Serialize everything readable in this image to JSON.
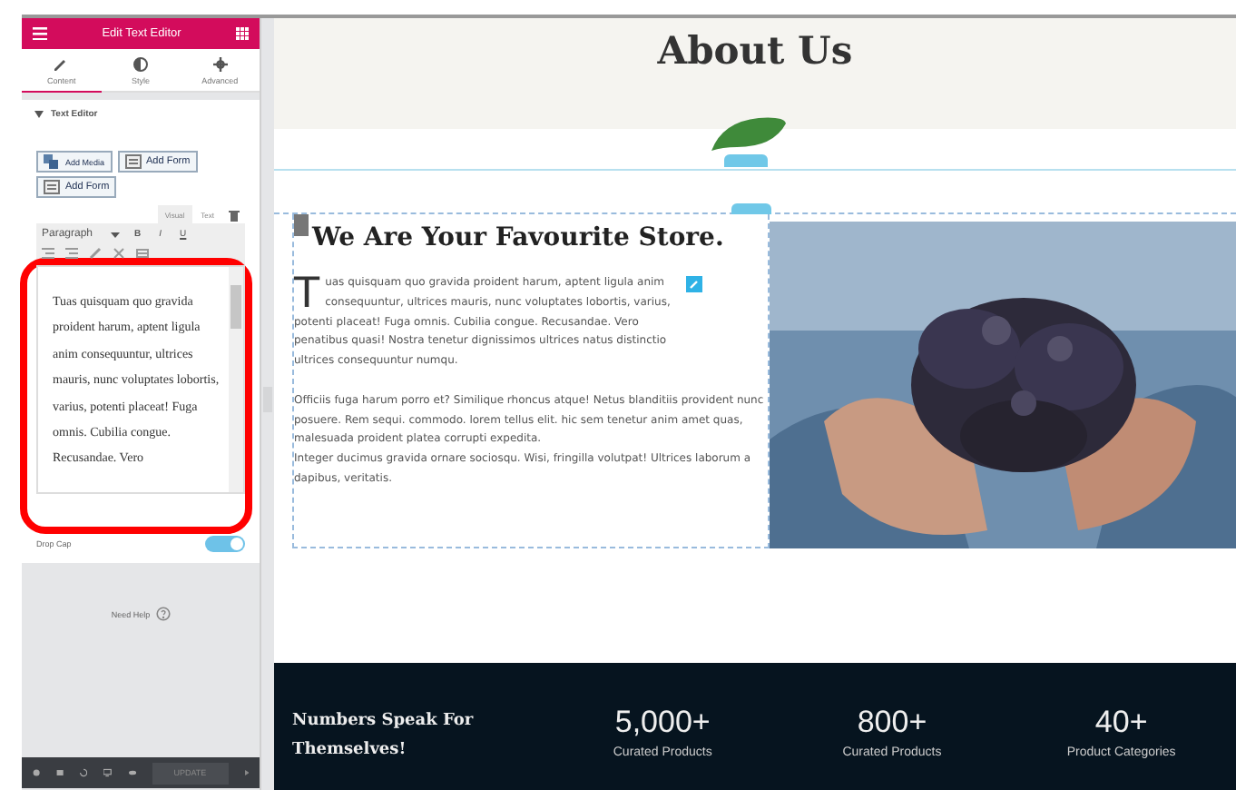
{
  "panel": {
    "title": "Edit Text Editor",
    "tabs": [
      {
        "label": "Content",
        "selected": true
      },
      {
        "label": "Style",
        "selected": false
      },
      {
        "label": "Advanced",
        "selected": false
      }
    ],
    "section": {
      "title": "Text Editor",
      "expanded": true
    },
    "media_buttons": [
      "Add Media",
      "Add Form",
      "Add Form"
    ],
    "editor_tabs": [
      {
        "label": "Visual",
        "selected": true
      },
      {
        "label": "Text",
        "selected": false
      }
    ],
    "format": "Paragraph",
    "format_buttons": [
      "B",
      "I",
      "U"
    ],
    "editor_text": "Tuas quisquam quo gravida proident harum, aptent ligula anim consequuntur, ultrices mauris, nunc voluptates lobortis, varius, potenti placeat! Fuga omnis. Cubilia congue. Recusandae. Vero",
    "drop_cap": {
      "label": "Drop Cap",
      "on": true
    },
    "help": "Need Help",
    "update": "UPDATE"
  },
  "page": {
    "title": "About Us",
    "heading": "We Are Your Favourite Store.",
    "intro": "Tuas quisquam quo gravida proident harum, aptent ligula anim consequuntur, ultrices mauris, nunc voluptates lobortis, varius, potenti placeat! Fuga omnis. Cubilia congue. Recusandae. Vero penatibus quasi! Nostra tenetur dignissimos ultrices natus distinctio ultrices consequuntur numqu.",
    "lines": [
      "Officiis fuga harum porro et? Similique rhoncus atque! Netus blanditiis provident nunc posuere. Rem sequi. commodo. lorem tellus elit. hic sem tenetur anim amet quas, malesuada proident platea corrupti expedita.",
      "Integer ducimus gravida ornare sociosqu. Wisi, fringilla volutpat! Ultrices laborum a dapibus, veritatis."
    ],
    "image": {
      "kind": "picture"
    },
    "stats_title": "Numbers Speak For Themselves!",
    "stats": [
      {
        "value": "5,000+",
        "label": "Curated Products"
      },
      {
        "value": "800+",
        "label": "Curated Products"
      },
      {
        "value": "40+",
        "label": "Product Categories"
      }
    ]
  }
}
